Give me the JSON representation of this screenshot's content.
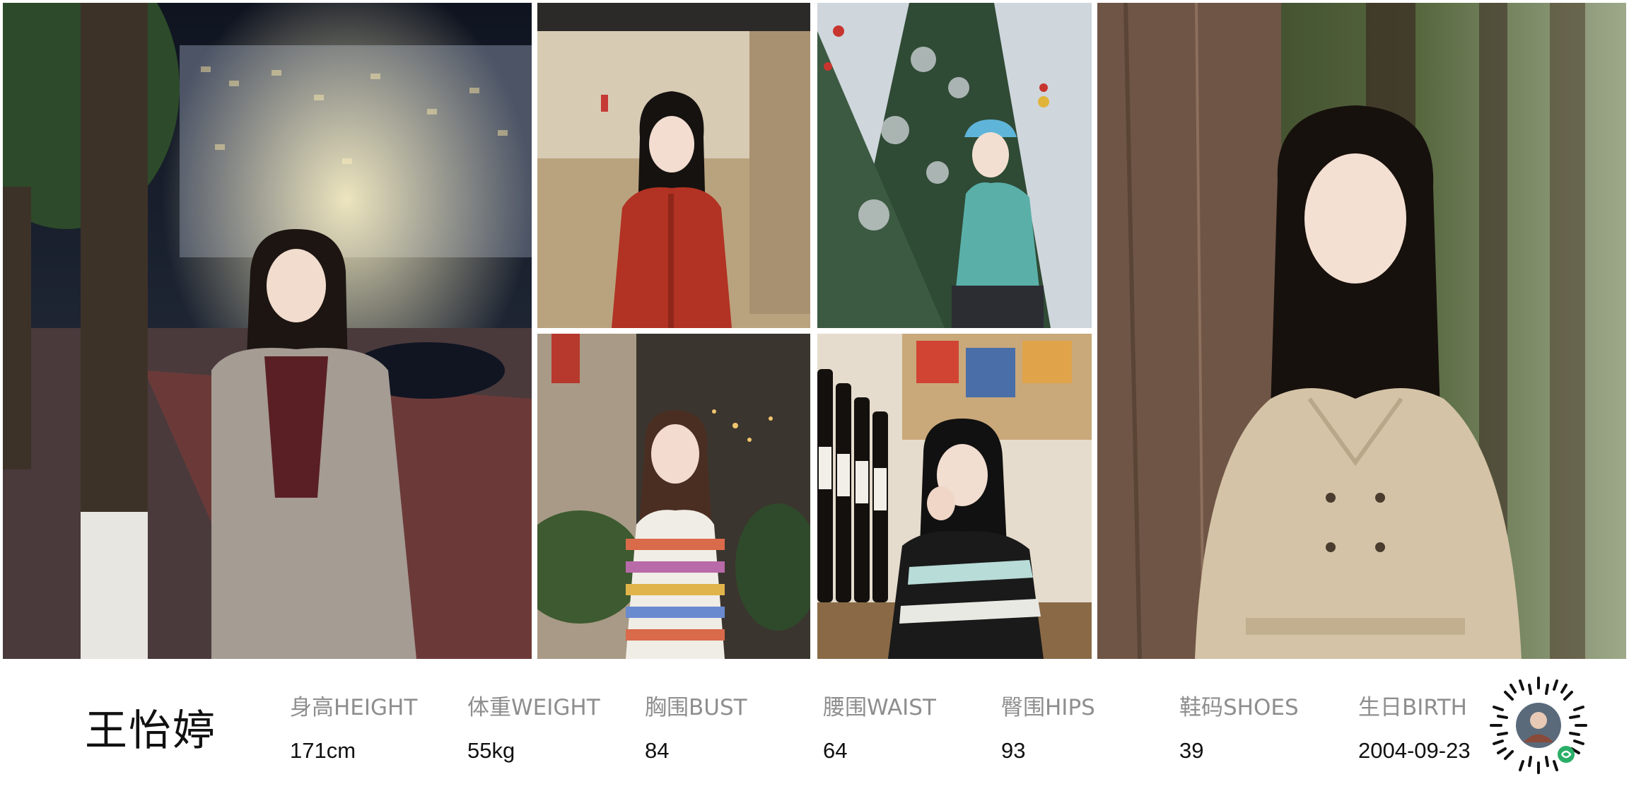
{
  "model": {
    "name": "王怡婷"
  },
  "stats": [
    {
      "label": "身高HEIGHT",
      "value": "171cm"
    },
    {
      "label": "体重WEIGHT",
      "value": "55kg"
    },
    {
      "label": "胸围BUST",
      "value": "84"
    },
    {
      "label": "腰围WAIST",
      "value": "64"
    },
    {
      "label": "臀围HIPS",
      "value": "93"
    },
    {
      "label": "鞋码SHOES",
      "value": "39"
    },
    {
      "label": "生日BIRTH",
      "value": "2004-09-23"
    }
  ],
  "colors": {
    "label_gray": "#8e8e8e",
    "value_black": "#111111",
    "qr_badge_green": "#2aae67"
  },
  "icons": {
    "qr": "mini-program-code-icon"
  }
}
